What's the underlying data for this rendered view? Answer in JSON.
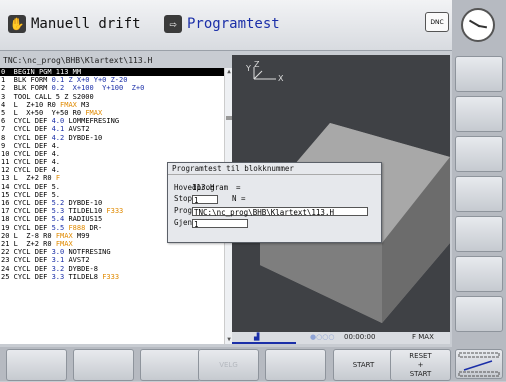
{
  "header": {
    "mode_manual": "Manuell drift",
    "mode_program": "Programtest",
    "dnc_label": "DNC"
  },
  "editor": {
    "path": "TNC:\\nc_prog\\BHB\\Klartext\\113.H",
    "lines": [
      {
        "num": "0",
        "segs": [
          {
            "t": "BEGIN PGM 113 MM",
            "c": ""
          }
        ]
      },
      {
        "num": "1",
        "segs": [
          {
            "t": "BLK FORM ",
            "c": ""
          },
          {
            "t": "0.1 Z X+0 Y+0 Z-20",
            "c": "n"
          }
        ]
      },
      {
        "num": "2",
        "segs": [
          {
            "t": "BLK FORM ",
            "c": ""
          },
          {
            "t": "0.2  X+100  Y+100  Z+0",
            "c": "n"
          }
        ]
      },
      {
        "num": "3",
        "segs": [
          {
            "t": "TOOL CALL 5 Z S2000",
            "c": ""
          }
        ]
      },
      {
        "num": "4",
        "segs": [
          {
            "t": "L  Z+10 R0 ",
            "c": ""
          },
          {
            "t": "FMAX",
            "c": "hl"
          },
          {
            "t": " M3",
            "c": ""
          }
        ]
      },
      {
        "num": "5",
        "segs": [
          {
            "t": "L  X+50  Y+50 R0 ",
            "c": ""
          },
          {
            "t": "FMAX",
            "c": "hl"
          }
        ]
      },
      {
        "num": "6",
        "segs": [
          {
            "t": "CYCL DEF ",
            "c": ""
          },
          {
            "t": "4.0",
            "c": "n"
          },
          {
            "t": " LOMMEFRESING",
            "c": ""
          }
        ]
      },
      {
        "num": "7",
        "segs": [
          {
            "t": "CYCL DEF ",
            "c": ""
          },
          {
            "t": "4.1",
            "c": "n"
          },
          {
            "t": " AVST2",
            "c": ""
          }
        ]
      },
      {
        "num": "8",
        "segs": [
          {
            "t": "CYCL DEF ",
            "c": ""
          },
          {
            "t": "4.2",
            "c": "n"
          },
          {
            "t": " DYBDE-10",
            "c": ""
          }
        ]
      },
      {
        "num": "9",
        "segs": [
          {
            "t": "CYCL DEF 4.",
            "c": ""
          }
        ]
      },
      {
        "num": "10",
        "segs": [
          {
            "t": "CYCL DEF 4.",
            "c": ""
          }
        ]
      },
      {
        "num": "11",
        "segs": [
          {
            "t": "CYCL DEF 4.",
            "c": ""
          }
        ]
      },
      {
        "num": "12",
        "segs": [
          {
            "t": "CYCL DEF 4.",
            "c": ""
          }
        ]
      },
      {
        "num": "13",
        "segs": [
          {
            "t": "L  Z+2 R0 ",
            "c": ""
          },
          {
            "t": "F",
            "c": "hl"
          }
        ]
      },
      {
        "num": "14",
        "segs": [
          {
            "t": "CYCL DEF 5.",
            "c": ""
          }
        ]
      },
      {
        "num": "15",
        "segs": [
          {
            "t": "CYCL DEF 5.",
            "c": ""
          }
        ]
      },
      {
        "num": "16",
        "segs": [
          {
            "t": "CYCL DEF ",
            "c": ""
          },
          {
            "t": "5.2",
            "c": "n"
          },
          {
            "t": " DYBDE-10",
            "c": ""
          }
        ]
      },
      {
        "num": "17",
        "segs": [
          {
            "t": "CYCL DEF ",
            "c": ""
          },
          {
            "t": "5.3",
            "c": "n"
          },
          {
            "t": " TILDEL10 ",
            "c": ""
          },
          {
            "t": "F333",
            "c": "hl"
          }
        ]
      },
      {
        "num": "18",
        "segs": [
          {
            "t": "CYCL DEF ",
            "c": ""
          },
          {
            "t": "5.4",
            "c": "n"
          },
          {
            "t": " RADIUS15",
            "c": ""
          }
        ]
      },
      {
        "num": "19",
        "segs": [
          {
            "t": "CYCL DEF ",
            "c": ""
          },
          {
            "t": "5.5",
            "c": "n"
          },
          {
            "t": " ",
            "c": ""
          },
          {
            "t": "F888",
            "c": "hl"
          },
          {
            "t": " DR-",
            "c": ""
          }
        ]
      },
      {
        "num": "20",
        "segs": [
          {
            "t": "L  Z-8 R0 ",
            "c": ""
          },
          {
            "t": "FMAX",
            "c": "hl"
          },
          {
            "t": " M99",
            "c": ""
          }
        ]
      },
      {
        "num": "21",
        "segs": [
          {
            "t": "L  Z+2 R0 ",
            "c": ""
          },
          {
            "t": "FMAX",
            "c": "hl"
          }
        ]
      },
      {
        "num": "22",
        "segs": [
          {
            "t": "CYCL DEF ",
            "c": ""
          },
          {
            "t": "3.0",
            "c": "n"
          },
          {
            "t": " NOTFRESING",
            "c": ""
          }
        ]
      },
      {
        "num": "23",
        "segs": [
          {
            "t": "CYCL DEF ",
            "c": ""
          },
          {
            "t": "3.1",
            "c": "n"
          },
          {
            "t": " AVST2",
            "c": ""
          }
        ]
      },
      {
        "num": "24",
        "segs": [
          {
            "t": "CYCL DEF ",
            "c": ""
          },
          {
            "t": "3.2",
            "c": "n"
          },
          {
            "t": " DYBDE-8",
            "c": ""
          }
        ]
      },
      {
        "num": "25",
        "segs": [
          {
            "t": "CYCL DEF ",
            "c": ""
          },
          {
            "t": "3.3",
            "c": "n"
          },
          {
            "t": " TILDEL8 ",
            "c": ""
          },
          {
            "t": "F333",
            "c": "hl"
          }
        ]
      }
    ]
  },
  "view": {
    "axis_y": "Y",
    "axis_z": "Z",
    "axis_x": "X"
  },
  "status": {
    "time": "00:00:00",
    "feed": "F MAX"
  },
  "dialog": {
    "title": "Programtest til blokknummer",
    "main_program_label": "Hovedprogram",
    "main_program_eq": "=",
    "main_program_value": "113.H",
    "stop_label": "Stopp ved:",
    "stop_n": "N =",
    "stop_value": "1",
    "program_label": "Program",
    "program_eq": "=",
    "program_value": "TNC:\\nc_prog\\BHB\\Klartext\\113.H",
    "repeat_label": "Gjentakelser",
    "repeat_eq": "=",
    "repeat_value": "1"
  },
  "softkeys": {
    "sk3": "VELG",
    "sk6": "START",
    "sk7_line1": "RESET",
    "sk7_line2": "+",
    "sk7_line3": "START"
  },
  "colors": {
    "number": "#1b2fa8",
    "highlight": "#e08a00",
    "view_bg": "#3f4145"
  }
}
